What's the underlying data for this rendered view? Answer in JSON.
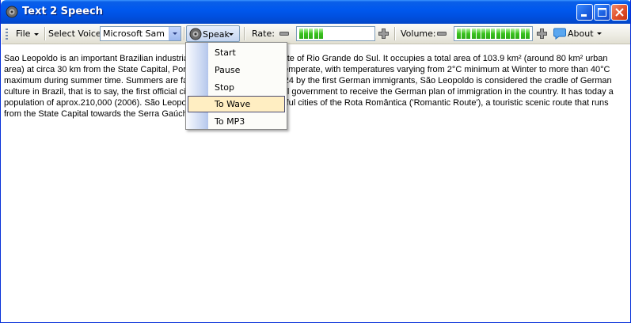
{
  "window": {
    "title": "Text 2 Speech"
  },
  "toolbar": {
    "file_label": "File",
    "voice_label": "Select Voice:",
    "voice_value": "Microsoft Sam",
    "speak_label": "Speak",
    "rate_label": "Rate:",
    "rate_level": 0.35,
    "volume_label": "Volume:",
    "volume_level": 1.0,
    "about_label": "About"
  },
  "speak_menu": {
    "items": [
      {
        "label": "Start"
      },
      {
        "label": "Pause"
      },
      {
        "label": "Stop"
      },
      {
        "label": "To Wave"
      },
      {
        "label": "To MP3"
      }
    ],
    "highlighted": 3
  },
  "content": {
    "text": "Sao Leopoldo is an important Brazilian industrial center, located in the state of Rio Grande do Sul. It occupies a total area of 103.9 km² (around 80 km² urban area) at circa 30 km from the State Capital, Porto Alegre. The climate is temperate, with temperatures varying from 2°C minimum at Winter to more than 40°C maximum during summer time. Summers are fairly dry. Established in 1824 by the first German immigrants, São Leopoldo is considered the cradle of German culture in Brazil, that is to say, the first official city designed by the national government to receive the German plan of immigration in the country. It has today a population of aprox.210,000 (2006). São Leopoldo is one of the 13 beautiful cities of the Rota Romântica ('Romantic Route'), a touristic scenic route that runs from the State Capital towards the Serra Gaúcha."
  },
  "colors": {
    "titlebar": "#0058ee",
    "meter_fill": "#39c21d",
    "menu_highlight": "#ffeec2"
  }
}
